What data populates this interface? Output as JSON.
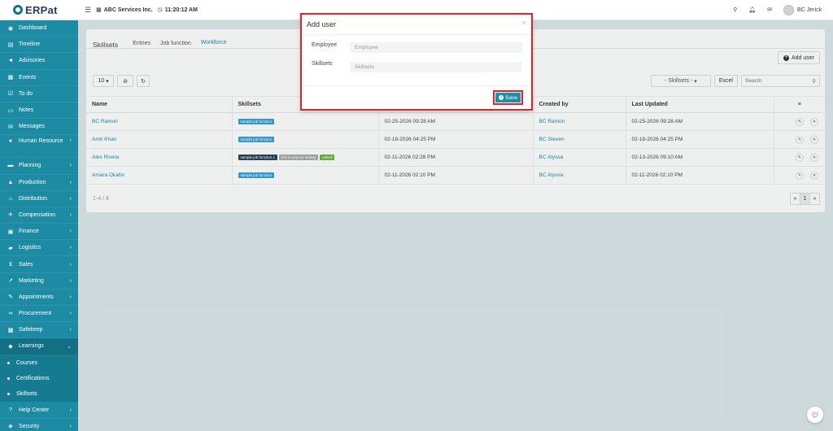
{
  "brand": {
    "logo_text": "ERPat"
  },
  "topbar": {
    "company": "ABC Services Inc.",
    "time": "11:20:12 AM",
    "user": "BC Jerick"
  },
  "sidebar": {
    "items": [
      {
        "label": "Dashboard",
        "icon": "dashboard-icon",
        "chev": ""
      },
      {
        "label": "Timeline",
        "icon": "timeline-icon",
        "chev": ""
      },
      {
        "label": "Advisories",
        "icon": "megaphone-icon",
        "chev": ""
      },
      {
        "label": "Events",
        "icon": "calendar-icon",
        "chev": ""
      },
      {
        "label": "To do",
        "icon": "checkbox-icon",
        "chev": ""
      },
      {
        "label": "Notes",
        "icon": "notes-icon",
        "chev": ""
      },
      {
        "label": "Messages",
        "icon": "envelope-icon",
        "chev": ""
      },
      {
        "label": "Human Resource",
        "icon": "users-icon",
        "chev": ">"
      },
      {
        "label": "Planning",
        "icon": "planning-icon",
        "chev": ">"
      },
      {
        "label": "Production",
        "icon": "production-icon",
        "chev": ">"
      },
      {
        "label": "Distribution",
        "icon": "bank-icon",
        "chev": ">"
      },
      {
        "label": "Compensation",
        "icon": "compensation-icon",
        "chev": ">"
      },
      {
        "label": "Finance",
        "icon": "money-icon",
        "chev": ">"
      },
      {
        "label": "Logistics",
        "icon": "truck-icon",
        "chev": ">"
      },
      {
        "label": "Sales",
        "icon": "cart-icon",
        "chev": ">"
      },
      {
        "label": "Marketing",
        "icon": "chart-icon",
        "chev": ">"
      },
      {
        "label": "Appointments",
        "icon": "edit-icon",
        "chev": ">"
      },
      {
        "label": "Procurement",
        "icon": "handshake-icon",
        "chev": ">"
      },
      {
        "label": "Safekeep",
        "icon": "safe-icon",
        "chev": ">"
      },
      {
        "label": "Learnings",
        "icon": "graduation-cap-icon",
        "chev": "v"
      }
    ],
    "subitems": [
      "Courses",
      "Certifications",
      "Skillsets"
    ],
    "bottom_items": [
      {
        "label": "Help Center",
        "icon": "help-icon",
        "chev": ">"
      },
      {
        "label": "Security",
        "icon": "shield-icon",
        "chev": ">"
      }
    ]
  },
  "page": {
    "title": "Skillsets",
    "tabs": [
      "Entries",
      "Job function",
      "Workforce"
    ],
    "active_tab": "Workforce",
    "add_user": "Add user",
    "page_size": "10",
    "skillsets_filter": "- Skillsets -",
    "excel": "Excel",
    "search_placeholder": "Search",
    "footer": "1-4 / 4",
    "current_page": "1"
  },
  "table": {
    "columns": [
      "Name",
      "Skillsets",
      "",
      "Created by",
      "Last Updated"
    ],
    "rows": [
      {
        "name": "BC Ramon",
        "tags": [
          {
            "text": "sample job function",
            "color": "#3a9fd6"
          }
        ],
        "date": "02-25-2026 09:28 AM",
        "created_by": "BC Ramon",
        "updated": "02-25-2026 09:28 AM"
      },
      {
        "name": "Amir Khan",
        "tags": [
          {
            "text": "sample job function",
            "color": "#3a9fd6"
          }
        ],
        "date": "02-18-2026 04:25 PM",
        "created_by": "BC Steven",
        "updated": "02-18-2026 04:25 PM"
      },
      {
        "name": "Alex Rivera",
        "tags": [
          {
            "text": "sample job function 1",
            "color": "#2a3f54"
          },
          {
            "text": "this is only for testing",
            "color": "#aaaaaa"
          },
          {
            "text": "edited",
            "color": "#6fb33f"
          }
        ],
        "date": "02-11-2026 02:28 PM",
        "created_by": "BC Alyssa",
        "updated": "02-13-2026 09:10 AM"
      },
      {
        "name": "Amara Okafor",
        "tags": [
          {
            "text": "sample job function",
            "color": "#3a9fd6"
          }
        ],
        "date": "02-11-2026 02:10 PM",
        "created_by": "BC Alyssa",
        "updated": "02-11-2026 02:10 PM"
      }
    ]
  },
  "modal": {
    "title": "Add user",
    "employee_label": "Employee",
    "employee_placeholder": "Employee",
    "skillsets_label": "Skillsets",
    "skillsets_placeholder": "Skillsets",
    "save": "Save"
  },
  "colors": {
    "sidebar": "#1d8ba3",
    "accent": "#1b8aa4",
    "highlight": "#e0202a"
  }
}
